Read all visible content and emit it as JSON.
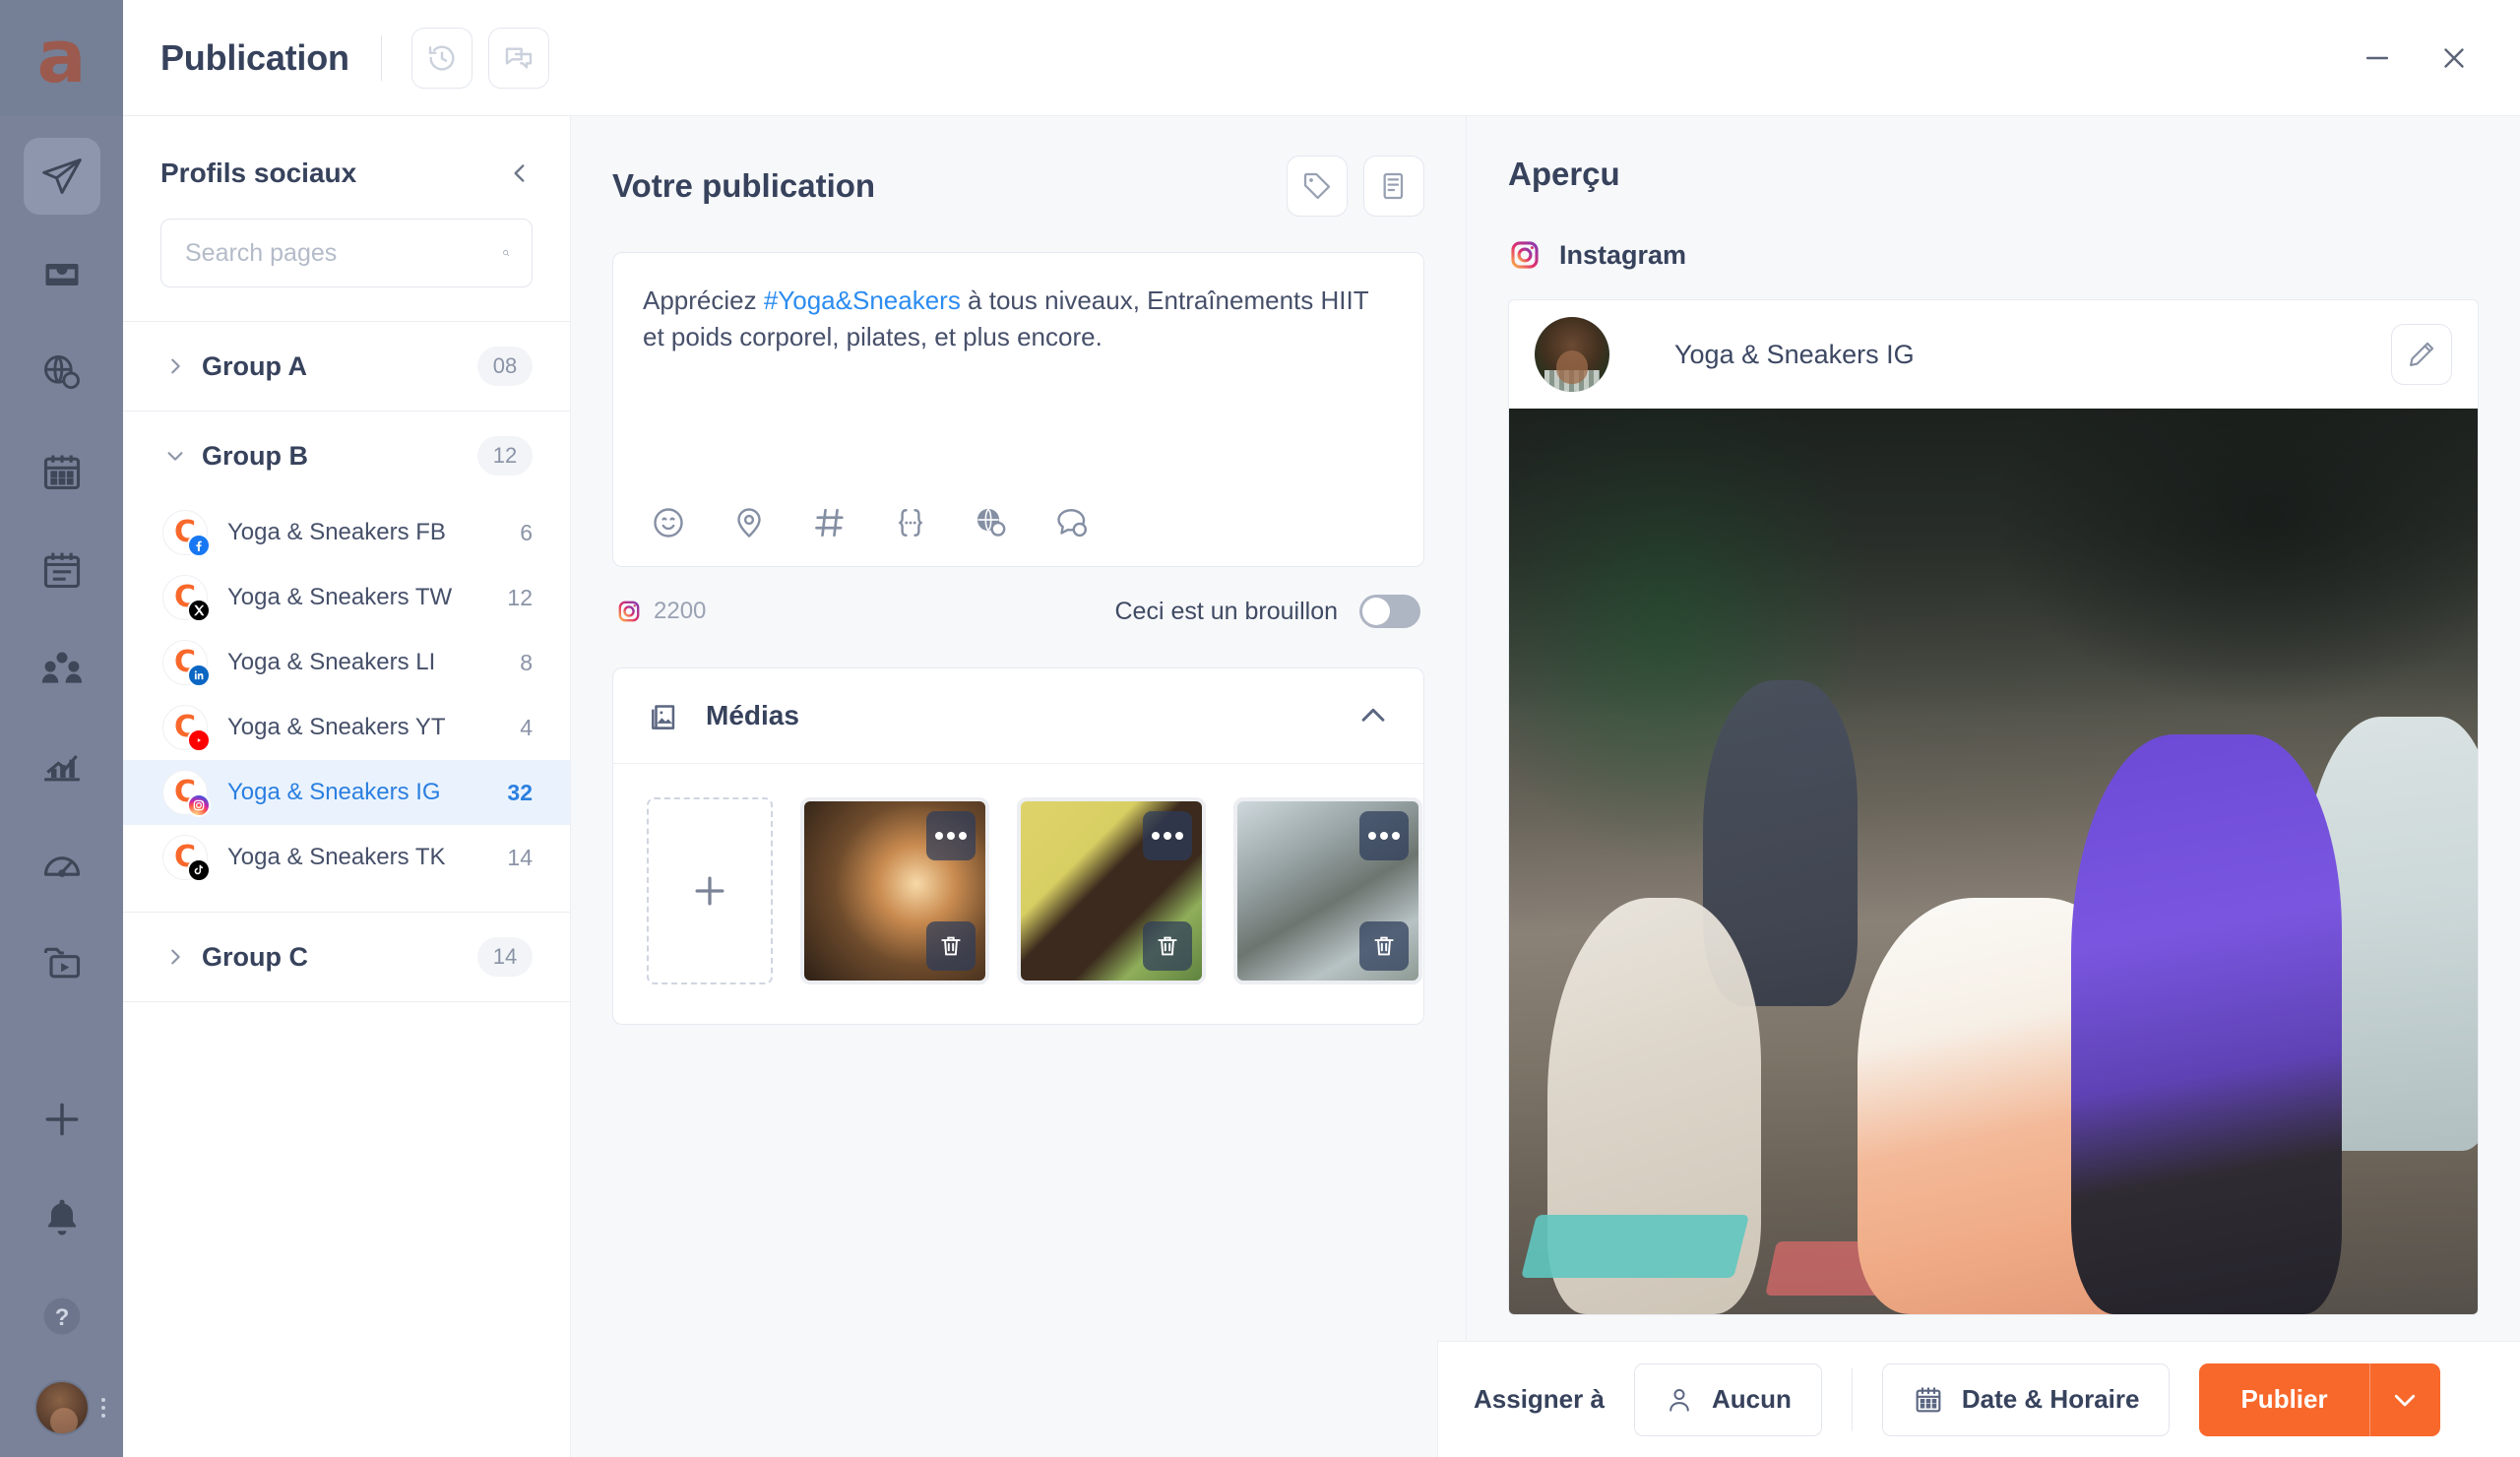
{
  "window": {
    "title": "Publication",
    "header_icons": [
      "history-icon",
      "comments-icon"
    ],
    "minimize": "−",
    "close": "×",
    "brand_glyph": "a"
  },
  "rail": {
    "items": [
      {
        "name": "publisher-icon",
        "active": true
      },
      {
        "name": "inbox-icon",
        "active": false
      },
      {
        "name": "globe-search-icon",
        "active": false
      },
      {
        "name": "calendar-icon",
        "active": false
      },
      {
        "name": "agenda-icon",
        "active": false
      },
      {
        "name": "users-icon",
        "active": false
      },
      {
        "name": "analytics-icon",
        "active": false
      },
      {
        "name": "gauge-icon",
        "active": false
      },
      {
        "name": "media-library-icon",
        "active": false
      }
    ],
    "bottom": [
      {
        "name": "add-icon"
      },
      {
        "name": "bell-icon"
      },
      {
        "name": "help-icon"
      },
      {
        "name": "profile-avatar"
      }
    ]
  },
  "sidebar": {
    "title": "Profils sociaux",
    "collapse_icon": "chevron-left-icon",
    "search": {
      "value": "",
      "placeholder": "Search pages",
      "icon": "search-icon"
    },
    "groups": [
      {
        "name": "Group A",
        "count": "08",
        "expanded": false,
        "profiles": []
      },
      {
        "name": "Group B",
        "count": "12",
        "expanded": true,
        "profiles": [
          {
            "name": "Yoga & Sneakers FB",
            "count": "6",
            "network": "facebook",
            "selected": false
          },
          {
            "name": "Yoga & Sneakers TW",
            "count": "12",
            "network": "twitter",
            "selected": false
          },
          {
            "name": "Yoga & Sneakers LI",
            "count": "8",
            "network": "linkedin",
            "selected": false
          },
          {
            "name": "Yoga & Sneakers YT",
            "count": "4",
            "network": "youtube",
            "selected": false
          },
          {
            "name": "Yoga & Sneakers IG",
            "count": "32",
            "network": "instagram",
            "selected": true
          },
          {
            "name": "Yoga & Sneakers TK",
            "count": "14",
            "network": "tiktok",
            "selected": false
          }
        ]
      },
      {
        "name": "Group C",
        "count": "14",
        "expanded": false,
        "profiles": []
      }
    ]
  },
  "composer": {
    "title": "Votre publication",
    "header_icons": [
      "tag-icon",
      "templates-icon"
    ],
    "editor": {
      "text_before": "Appréciez ",
      "hashtag": "#Yoga&Sneakers",
      "text_after": " à tous niveaux, Entraînements HIIT et poids corporel, pilates, et plus encore."
    },
    "tools": [
      "emoji-icon",
      "location-icon",
      "hashtag-icon",
      "variable-icon",
      "globe-search-icon",
      "chat-search-icon"
    ],
    "char_count": "2200",
    "char_count_network": "instagram",
    "draft_label": "Ceci est un brouillon",
    "draft_on": false,
    "media": {
      "title": "Médias",
      "icon": "images-icon",
      "collapse_icon": "chevron-up-icon",
      "add_label": "+",
      "items": [
        {
          "alt": "meditation-sunset-deck",
          "menu_icon": "more-icon",
          "delete_icon": "trash-icon"
        },
        {
          "alt": "yoga-mat-grass",
          "menu_icon": "more-icon",
          "delete_icon": "trash-icon"
        },
        {
          "alt": "stacked-stones",
          "menu_icon": "more-icon",
          "delete_icon": "trash-icon"
        }
      ]
    }
  },
  "preview": {
    "title": "Aperçu",
    "network": "Instagram",
    "network_icon": "instagram-icon",
    "account_name": "Yoga & Sneakers IG",
    "edit_icon": "pencil-icon",
    "photo_alt": "yoga-class-warrior-pose"
  },
  "actionbar": {
    "assign_label": "Assigner à",
    "assignee": "Aucun",
    "assignee_icon": "person-icon",
    "schedule": "Date & Horaire",
    "schedule_icon": "calendar-icon",
    "publish": "Publier",
    "publish_caret_icon": "chevron-down-icon"
  },
  "colors": {
    "accent_orange": "#f8682b",
    "rail_bg": "#7a8299",
    "text_dark": "#37425c",
    "link_blue": "#2b8cf0",
    "selected_bg": "#eaf3fd"
  }
}
